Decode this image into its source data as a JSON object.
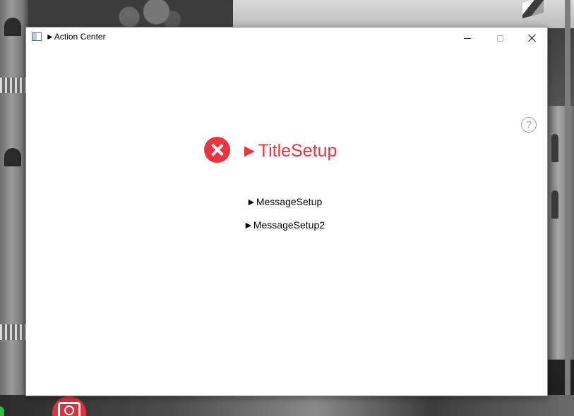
{
  "window": {
    "title": "►Action Center",
    "help_symbol": "?"
  },
  "notification": {
    "icon": "error-icon",
    "title": "►TitleSetup",
    "messages": [
      "►MessageSetup",
      "►MessageSetup2"
    ]
  },
  "colors": {
    "accent": "#e8353f",
    "window_bg": "#ffffff"
  }
}
